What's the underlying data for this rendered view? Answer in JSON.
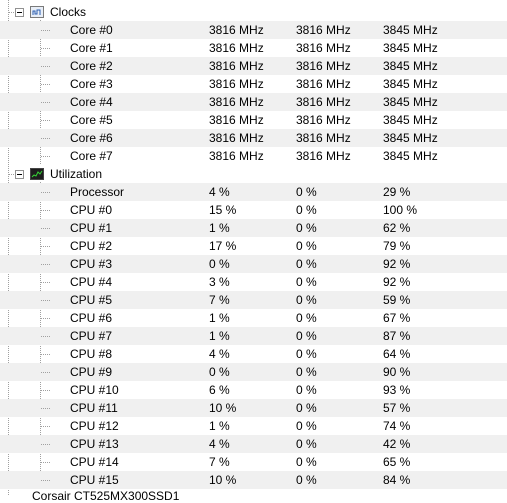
{
  "clocks": {
    "label": "Clocks",
    "rows": [
      {
        "name": "Core #0",
        "current": "3816 MHz",
        "min": "3816 MHz",
        "max": "3845 MHz"
      },
      {
        "name": "Core #1",
        "current": "3816 MHz",
        "min": "3816 MHz",
        "max": "3845 MHz"
      },
      {
        "name": "Core #2",
        "current": "3816 MHz",
        "min": "3816 MHz",
        "max": "3845 MHz"
      },
      {
        "name": "Core #3",
        "current": "3816 MHz",
        "min": "3816 MHz",
        "max": "3845 MHz"
      },
      {
        "name": "Core #4",
        "current": "3816 MHz",
        "min": "3816 MHz",
        "max": "3845 MHz"
      },
      {
        "name": "Core #5",
        "current": "3816 MHz",
        "min": "3816 MHz",
        "max": "3845 MHz"
      },
      {
        "name": "Core #6",
        "current": "3816 MHz",
        "min": "3816 MHz",
        "max": "3845 MHz"
      },
      {
        "name": "Core #7",
        "current": "3816 MHz",
        "min": "3816 MHz",
        "max": "3845 MHz"
      }
    ]
  },
  "utilization": {
    "label": "Utilization",
    "rows": [
      {
        "name": "Processor",
        "current": "4 %",
        "min": "0 %",
        "max": "29 %"
      },
      {
        "name": "CPU #0",
        "current": "15 %",
        "min": "0 %",
        "max": "100 %"
      },
      {
        "name": "CPU #1",
        "current": "1 %",
        "min": "0 %",
        "max": "62 %"
      },
      {
        "name": "CPU #2",
        "current": "17 %",
        "min": "0 %",
        "max": "79 %"
      },
      {
        "name": "CPU #3",
        "current": "0 %",
        "min": "0 %",
        "max": "92 %"
      },
      {
        "name": "CPU #4",
        "current": "3 %",
        "min": "0 %",
        "max": "92 %"
      },
      {
        "name": "CPU #5",
        "current": "7 %",
        "min": "0 %",
        "max": "59 %"
      },
      {
        "name": "CPU #6",
        "current": "1 %",
        "min": "0 %",
        "max": "67 %"
      },
      {
        "name": "CPU #7",
        "current": "1 %",
        "min": "0 %",
        "max": "87 %"
      },
      {
        "name": "CPU #8",
        "current": "4 %",
        "min": "0 %",
        "max": "64 %"
      },
      {
        "name": "CPU #9",
        "current": "0 %",
        "min": "0 %",
        "max": "90 %"
      },
      {
        "name": "CPU #10",
        "current": "6 %",
        "min": "0 %",
        "max": "93 %"
      },
      {
        "name": "CPU #11",
        "current": "10 %",
        "min": "0 %",
        "max": "57 %"
      },
      {
        "name": "CPU #12",
        "current": "1 %",
        "min": "0 %",
        "max": "74 %"
      },
      {
        "name": "CPU #13",
        "current": "4 %",
        "min": "0 %",
        "max": "42 %"
      },
      {
        "name": "CPU #14",
        "current": "7 %",
        "min": "0 %",
        "max": "65 %"
      },
      {
        "name": "CPU #15",
        "current": "10 %",
        "min": "0 %",
        "max": "84 %"
      }
    ]
  },
  "next_node": {
    "label": "Corsair CT525MX300SSD1"
  },
  "icons": {
    "clocks": "clock-icon",
    "utilization": "utilization-graph-icon",
    "toggle": "collapse-toggle-icon"
  }
}
